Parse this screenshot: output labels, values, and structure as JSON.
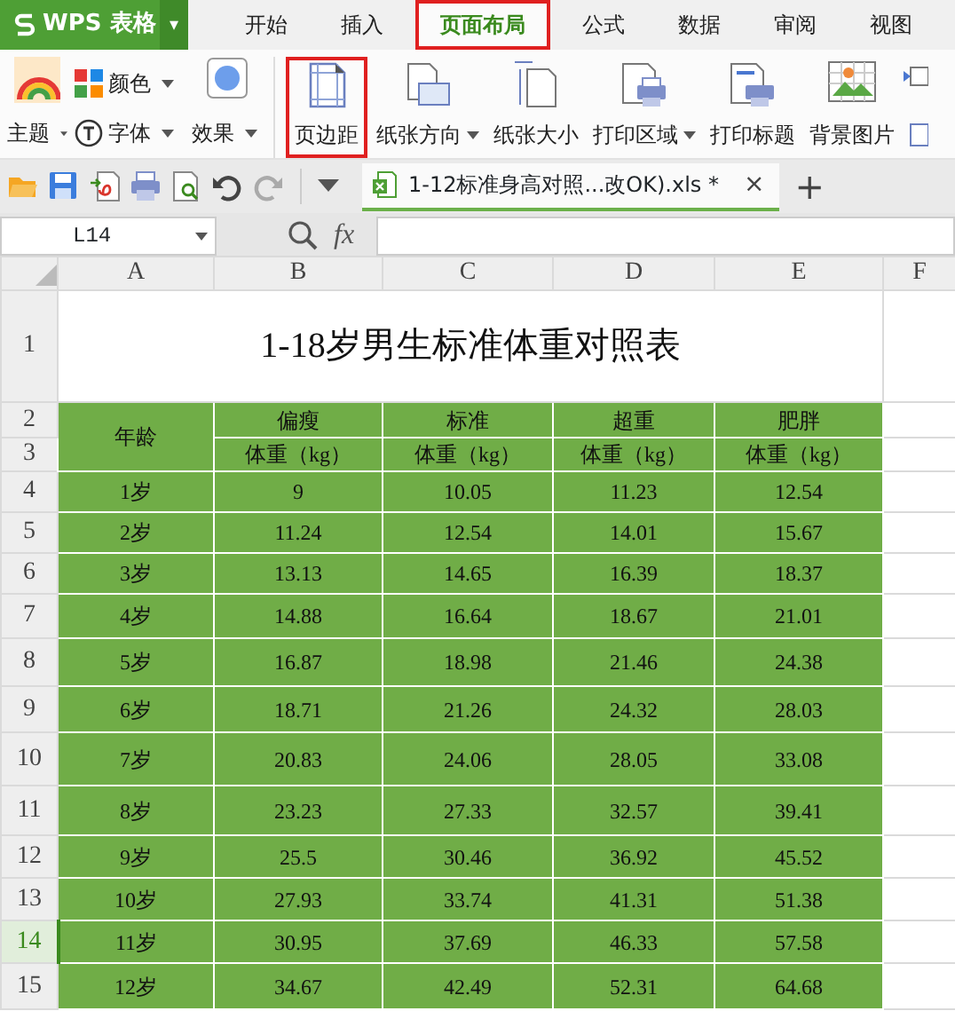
{
  "app": {
    "logo": "WPS 表格",
    "menu_caret": "▾"
  },
  "tabs": [
    {
      "label": "开始",
      "selected": false,
      "highlighted": false
    },
    {
      "label": "插入",
      "selected": false,
      "highlighted": false
    },
    {
      "label": "页面布局",
      "selected": true,
      "highlighted": true
    },
    {
      "label": "公式",
      "selected": false,
      "highlighted": false
    },
    {
      "label": "数据",
      "selected": false,
      "highlighted": false
    },
    {
      "label": "审阅",
      "selected": false,
      "highlighted": false
    },
    {
      "label": "视图",
      "selected": false,
      "highlighted": false
    }
  ],
  "ribbon": {
    "theme_group": [
      {
        "kind": "large",
        "label": "主题",
        "dropdown": true
      },
      {
        "kind": "small",
        "label": "颜色",
        "dropdown": true
      },
      {
        "kind": "small",
        "label": "字体",
        "dropdown": true
      },
      {
        "kind": "large",
        "label": "效果",
        "dropdown": true
      }
    ],
    "buttons": [
      {
        "label": "页边距",
        "dropdown": false,
        "highlighted": true
      },
      {
        "label": "纸张方向",
        "dropdown": true,
        "highlighted": false
      },
      {
        "label": "纸张大小",
        "dropdown": false,
        "highlighted": false
      },
      {
        "label": "打印区域",
        "dropdown": true,
        "highlighted": false
      },
      {
        "label": "打印标题",
        "dropdown": false,
        "highlighted": false
      },
      {
        "label": "背景图片",
        "dropdown": false,
        "highlighted": false
      }
    ]
  },
  "document_tab": {
    "title": "1-12标准身高对照...改OK).xls",
    "modified": "*",
    "close": "×",
    "new_tab": "+"
  },
  "formula_bar": {
    "name_box": "L14",
    "fx": "fx"
  },
  "sheet": {
    "columns": [
      {
        "label": "A",
        "selected": false
      },
      {
        "label": "B",
        "selected": false
      },
      {
        "label": "C",
        "selected": false
      },
      {
        "label": "D",
        "selected": false
      },
      {
        "label": "E",
        "selected": false
      },
      {
        "label": "F",
        "selected": false
      }
    ],
    "row_numbers": [
      {
        "label": "1",
        "selected": false
      },
      {
        "label": "2",
        "selected": false
      },
      {
        "label": "3",
        "selected": false
      },
      {
        "label": "4",
        "selected": false
      },
      {
        "label": "5",
        "selected": false
      },
      {
        "label": "6",
        "selected": false
      },
      {
        "label": "7",
        "selected": false
      },
      {
        "label": "8",
        "selected": false
      },
      {
        "label": "9",
        "selected": false
      },
      {
        "label": "10",
        "selected": false
      },
      {
        "label": "11",
        "selected": false
      },
      {
        "label": "12",
        "selected": false
      },
      {
        "label": "13",
        "selected": false
      },
      {
        "label": "14",
        "selected": true
      },
      {
        "label": "15",
        "selected": false
      }
    ],
    "title": "1-18岁男生标准体重对照表",
    "age_header": "年龄",
    "category_headers": [
      "偏瘦",
      "标准",
      "超重",
      "肥胖"
    ],
    "unit_headers": [
      "体重（kg）",
      "体重（kg）",
      "体重（kg）",
      "体重（kg）"
    ],
    "rows": [
      [
        "1岁",
        "9",
        "10.05",
        "11.23",
        "12.54"
      ],
      [
        "2岁",
        "11.24",
        "12.54",
        "14.01",
        "15.67"
      ],
      [
        "3岁",
        "13.13",
        "14.65",
        "16.39",
        "18.37"
      ],
      [
        "4岁",
        "14.88",
        "16.64",
        "18.67",
        "21.01"
      ],
      [
        "5岁",
        "16.87",
        "18.98",
        "21.46",
        "24.38"
      ],
      [
        "6岁",
        "18.71",
        "21.26",
        "24.32",
        "28.03"
      ],
      [
        "7岁",
        "20.83",
        "24.06",
        "28.05",
        "33.08"
      ],
      [
        "8岁",
        "23.23",
        "27.33",
        "32.57",
        "39.41"
      ],
      [
        "9岁",
        "25.5",
        "30.46",
        "36.92",
        "45.52"
      ],
      [
        "10岁",
        "27.93",
        "33.74",
        "41.31",
        "51.38"
      ],
      [
        "11岁",
        "30.95",
        "37.69",
        "46.33",
        "57.58"
      ],
      [
        "12岁",
        "34.67",
        "42.49",
        "52.31",
        "64.68"
      ]
    ]
  }
}
